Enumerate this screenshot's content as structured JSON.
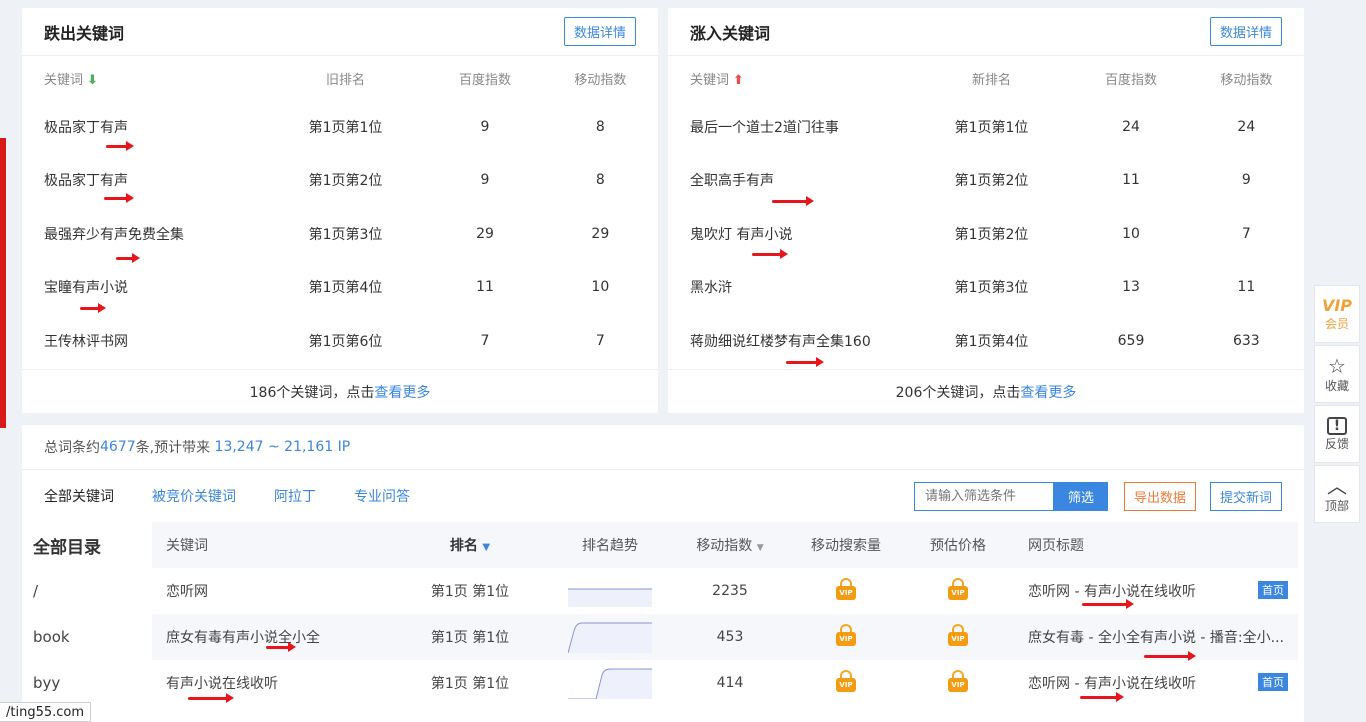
{
  "drop_panel": {
    "title": "跌出关键词",
    "detail_button": "数据详情",
    "headers": {
      "keyword": "关键词",
      "rank": "旧排名",
      "baidu": "百度指数",
      "mobile": "移动指数"
    },
    "rows": [
      {
        "keyword": "极品家丁有声",
        "rank": "第1页第1位",
        "baidu": "9",
        "mobile": "8"
      },
      {
        "keyword": "极品家丁有声",
        "rank": "第1页第2位",
        "baidu": "9",
        "mobile": "8"
      },
      {
        "keyword": "最强弃少有声免费全集",
        "rank": "第1页第3位",
        "baidu": "29",
        "mobile": "29"
      },
      {
        "keyword": "宝瞳有声小说",
        "rank": "第1页第4位",
        "baidu": "11",
        "mobile": "10"
      },
      {
        "keyword": "王传林评书网",
        "rank": "第1页第6位",
        "baidu": "7",
        "mobile": "7"
      }
    ],
    "footer_text": "186个关键词，点击",
    "footer_link": "查看更多"
  },
  "rise_panel": {
    "title": "涨入关键词",
    "detail_button": "数据详情",
    "headers": {
      "keyword": "关键词",
      "rank": "新排名",
      "baidu": "百度指数",
      "mobile": "移动指数"
    },
    "rows": [
      {
        "keyword": "最后一个道士2道门往事",
        "rank": "第1页第1位",
        "baidu": "24",
        "mobile": "24"
      },
      {
        "keyword": "全职高手有声",
        "rank": "第1页第2位",
        "baidu": "11",
        "mobile": "9"
      },
      {
        "keyword": "鬼吹灯 有声小说",
        "rank": "第1页第2位",
        "baidu": "10",
        "mobile": "7"
      },
      {
        "keyword": "黑水浒",
        "rank": "第1页第3位",
        "baidu": "13",
        "mobile": "11"
      },
      {
        "keyword": "蒋勋细说红楼梦有声全集160",
        "rank": "第1页第4位",
        "baidu": "659",
        "mobile": "633"
      }
    ],
    "footer_text": "206个关键词，点击",
    "footer_link": "查看更多"
  },
  "summary": {
    "prefix": "总词条约",
    "count": "4677",
    "middle": "条,预计带来 ",
    "ip_range": "13,247 ~ 21,161 IP"
  },
  "tabs": [
    "全部关键词",
    "被竞价关键词",
    "阿拉丁",
    "专业问答"
  ],
  "filter": {
    "placeholder": "请输入筛选条件",
    "button": "筛选"
  },
  "export_button": "导出数据",
  "submit_button": "提交新词",
  "directory": {
    "title": "全部目录",
    "items": [
      "/",
      "book",
      "byy"
    ]
  },
  "rank_table": {
    "headers": {
      "keyword": "关键词",
      "rank": "排名",
      "trend": "排名趋势",
      "mobile": "移动指数",
      "search": "移动搜索量",
      "price": "预估价格",
      "title": "网页标题"
    },
    "rows": [
      {
        "keyword": "恋听网",
        "rank": "第1页 第1位",
        "mobile": "2235",
        "title": "恋听网 - 有声小说在线收听",
        "badge": "首页"
      },
      {
        "keyword": "庶女有毒有声小说全小全",
        "rank": "第1页 第1位",
        "mobile": "453",
        "title": "庶女有毒 - 全小全有声小说 - 播音:全小...",
        "badge": ""
      },
      {
        "keyword": "有声小说在线收听",
        "rank": "第1页 第1位",
        "mobile": "414",
        "title": "恋听网 - 有声小说在线收听",
        "badge": "首页"
      }
    ],
    "lock_text": "VIP"
  },
  "side_dock": {
    "vip_icon_text": "VIP",
    "vip": "会员",
    "favorite": "收藏",
    "feedback": "反馈",
    "top": "顶部"
  },
  "status_url": "/ting55.com",
  "colors": {
    "accent": "#3a86e0",
    "annotation_arrow": "#e8151b",
    "lock": "#f39c12"
  }
}
